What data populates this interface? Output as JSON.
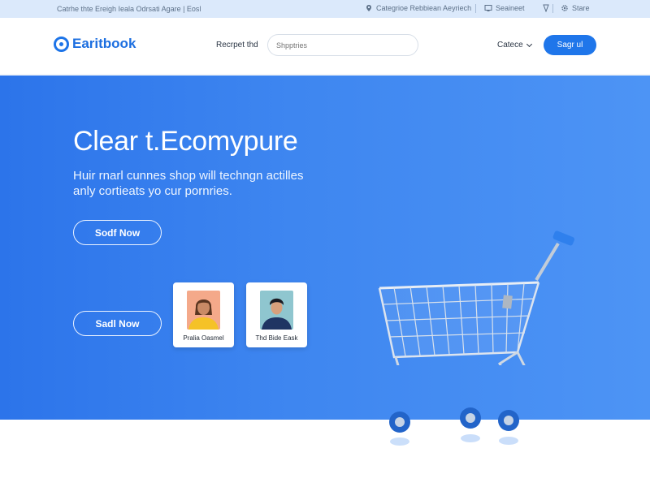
{
  "topbar": {
    "tagline": "Catrhe thte Ereigh Ieala Odrsati Agare | Eosl",
    "categories_label": "Categrioe Rebbiean Aeyriech",
    "account_label": "Seaineet",
    "store_label": "Stare"
  },
  "header": {
    "logo": "Earitbook",
    "nav_link": "Recrpet thd",
    "search_placeholder": "Shpptries",
    "language": "Catece",
    "cta": "Sagr ul"
  },
  "hero": {
    "title": "Clear t.Ecomypure",
    "subtitle_line1": "Huir rnarl cunnes shop will techngn actilles",
    "subtitle_line2": "anly cortieats yo cur pornries.",
    "button_primary": "Sodf Now",
    "button_secondary": "Sadl Now"
  },
  "cards": [
    {
      "label": "Pralia Oasmel",
      "icon": "person-avatar-yellow"
    },
    {
      "label": "Thd Bide Eask",
      "icon": "person-avatar-navy"
    }
  ],
  "colors": {
    "brand": "#1d74e8",
    "hero_start": "#2c74ea",
    "hero_end": "#4d94f5",
    "cart_accent": "#2f80ed"
  }
}
